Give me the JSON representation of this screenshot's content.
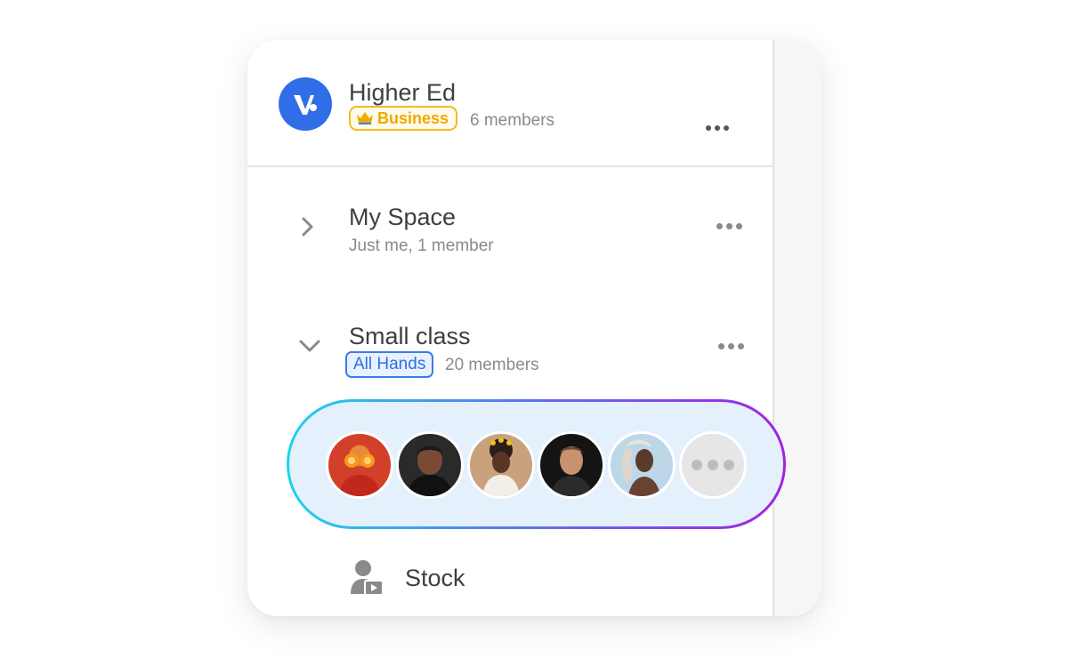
{
  "workspace": {
    "title": "Higher Ed",
    "plan_badge": "Business",
    "members": "6 members",
    "brand_color": "#2f6ee6"
  },
  "spaces": [
    {
      "title": "My Space",
      "subtitle": "Just me, 1 member",
      "expanded": false
    },
    {
      "title": "Small class",
      "badge": "All Hands",
      "members": "20 members",
      "expanded": true
    }
  ],
  "member_strip": {
    "avatars": [
      "member-avatar-1",
      "member-avatar-2",
      "member-avatar-3",
      "member-avatar-4",
      "member-avatar-5"
    ],
    "more_icon": "more-members-icon",
    "gradient": [
      "#1ed3ea",
      "#a321e4"
    ]
  },
  "stock": {
    "label": "Stock",
    "icon": "stock-user-video-icon"
  }
}
